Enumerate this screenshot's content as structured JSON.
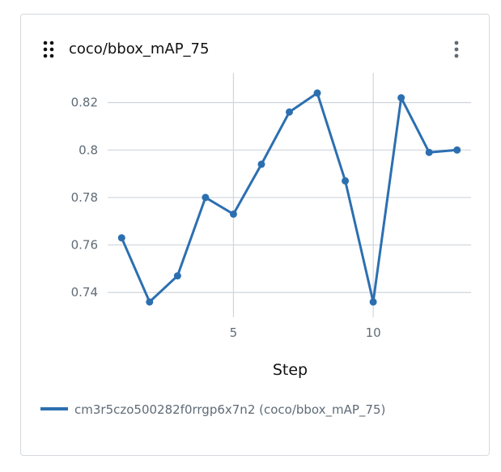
{
  "panel": {
    "title": "coco/bbox_mAP_75",
    "drag_icon": "drag-dots-icon",
    "menu_icon": "vertical-ellipsis-icon"
  },
  "colors": {
    "line": "#2c6fb0",
    "grid": "#cfd6dd",
    "text": "#5f6b77"
  },
  "chart_data": {
    "type": "line",
    "xlabel": "Step",
    "ylabel": "",
    "xlim": [
      0.5,
      13.5
    ],
    "ylim": [
      0.7295,
      0.8325
    ],
    "xticks": [
      5,
      10
    ],
    "yticks": [
      0.74,
      0.76,
      0.78,
      0.8,
      0.82
    ],
    "ytick_labels": [
      "0.74",
      "0.76",
      "0.78",
      "0.8",
      "0.82"
    ],
    "grid": true,
    "legend_position": "bottom-left",
    "series": [
      {
        "name": "cm3r5czo500282f0rrgp6x7n2 (coco/bbox_mAP_75)",
        "x": [
          1,
          2,
          3,
          4,
          5,
          6,
          7,
          8,
          9,
          10,
          11,
          12,
          13
        ],
        "y": [
          0.763,
          0.736,
          0.747,
          0.78,
          0.773,
          0.794,
          0.816,
          0.824,
          0.787,
          0.736,
          0.822,
          0.799,
          0.8
        ]
      }
    ]
  }
}
